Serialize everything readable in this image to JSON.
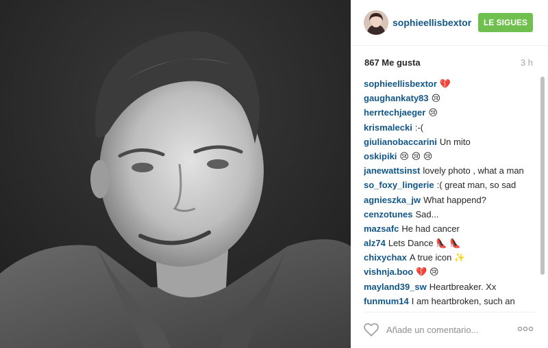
{
  "post": {
    "username": "sophieellisbextor",
    "follow_label": "LE SIGUES",
    "likes": "867 Me gusta",
    "time": "3 h",
    "comment_placeholder": "Añade un comentario...",
    "photo_description_icon": "bw-portrait-photo"
  },
  "comments": [
    {
      "user": "sophieellisbextor",
      "text": "💔"
    },
    {
      "user": "gaughankaty83",
      "text": "😢"
    },
    {
      "user": "herrtechjaeger",
      "text": "😢"
    },
    {
      "user": "krismalecki",
      "text": ":-("
    },
    {
      "user": "giulianobaccarini",
      "text": "Un mito"
    },
    {
      "user": "oskipiki",
      "text": "😢 😢 😢"
    },
    {
      "user": "janewattsinst",
      "text": "lovely photo , what a man"
    },
    {
      "user": "so_foxy_lingerie",
      "text": ":( great man, so sad"
    },
    {
      "user": "agnieszka_jw",
      "text": "What happend?"
    },
    {
      "user": "cenzotunes",
      "text": "Sad..."
    },
    {
      "user": "mazsafc",
      "text": "He had cancer"
    },
    {
      "user": "alz74",
      "text": "Lets Dance 👠 👠"
    },
    {
      "user": "chixychax",
      "text": "A true icon ✨"
    },
    {
      "user": "vishnja.boo",
      "text": "💔 😢"
    },
    {
      "user": "mayland39_sw",
      "text": "Heartbreaker. Xx"
    },
    {
      "user": "funmum14",
      "text": "I am heartbroken, such an"
    }
  ],
  "colors": {
    "username_blue": "#125688",
    "follow_green": "#70c050",
    "time_gray": "#a5a7aa"
  },
  "icons": {
    "heart": "heart-outline-icon",
    "more": "more-options-icon"
  }
}
